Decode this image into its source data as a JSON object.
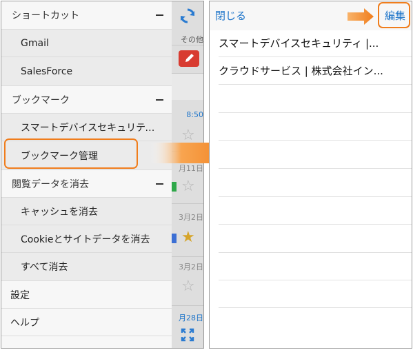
{
  "left_screen": {
    "drawer": {
      "sections": [
        {
          "header": "ショートカット",
          "items": [
            "Gmail",
            "SalesForce"
          ]
        },
        {
          "header": "ブックマーク",
          "items": [
            "スマートデバイスセキュリティ…",
            "ブックマーク管理"
          ]
        },
        {
          "header": "閲覧データを消去",
          "items": [
            "キャッシュを消去",
            "Cookieとサイトデータを消去",
            "すべて消去"
          ]
        }
      ],
      "bottom_items": [
        "設定",
        "ヘルプ"
      ]
    },
    "background_app": {
      "tab_label": "その他",
      "dates": [
        "8:50",
        "月11日",
        "3月2日",
        "3月2日",
        "月28日"
      ]
    }
  },
  "right_screen": {
    "close_label": "閉じる",
    "edit_label": "編集",
    "bookmarks": [
      "スマートデバイスセキュリティ |...",
      "クラウドサービス | 株式会社イン..."
    ]
  },
  "colors": {
    "highlight_orange": "#f07d1c",
    "link_blue": "#1d74c9",
    "compose_red": "#d83b30"
  }
}
